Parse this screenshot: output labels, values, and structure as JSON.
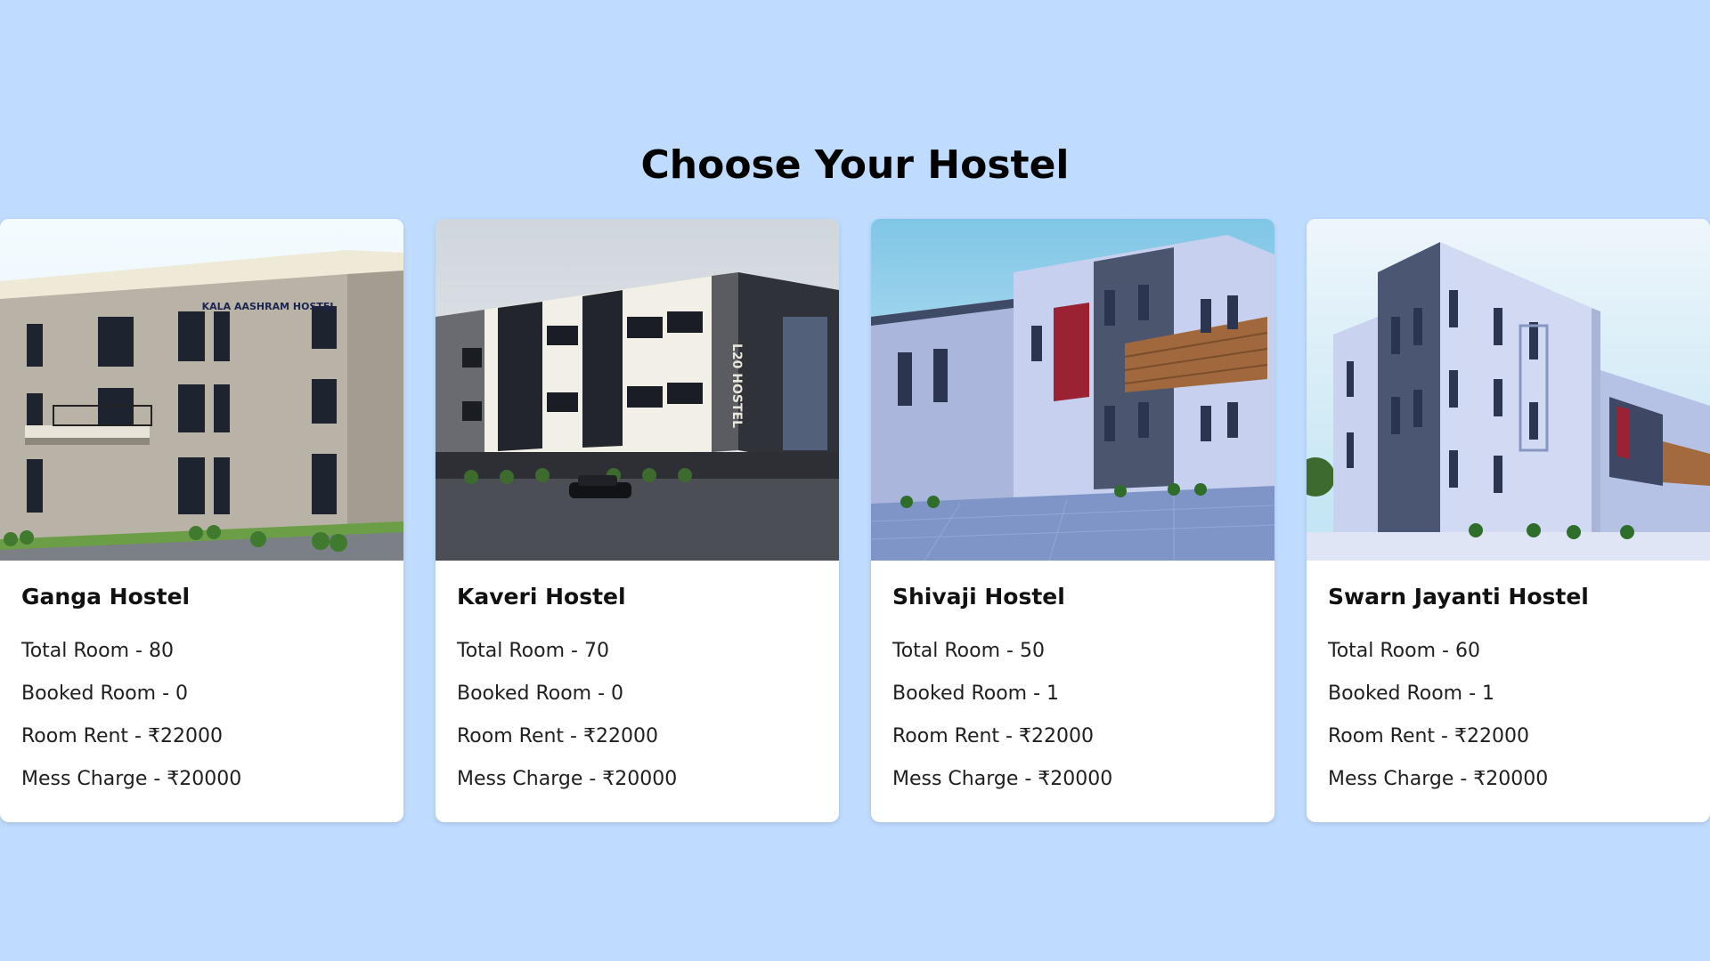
{
  "page": {
    "heading": "Choose Your Hostel",
    "background_color": "#bfdbfe"
  },
  "hostels": [
    {
      "name": "Ganga Hostel",
      "image": "hostel-building-photo",
      "sign_text": "KALA AASHRAM HOSTEL",
      "total_room": "Total Room - 80",
      "booked_room": "Booked Room - 0",
      "room_rent": "Room Rent - ₹22000",
      "mess_charge": "Mess Charge - ₹20000"
    },
    {
      "name": "Kaveri Hostel",
      "image": "hostel-building-photo",
      "sign_text": "L20 HOSTEL",
      "total_room": "Total Room - 70",
      "booked_room": "Booked Room - 0",
      "room_rent": "Room Rent - ₹22000",
      "mess_charge": "Mess Charge - ₹20000"
    },
    {
      "name": "Shivaji Hostel",
      "image": "hostel-building-photo",
      "total_room": "Total Room - 50",
      "booked_room": "Booked Room - 1",
      "room_rent": "Room Rent - ₹22000",
      "mess_charge": "Mess Charge - ₹20000"
    },
    {
      "name": "Swarn Jayanti Hostel",
      "image": "hostel-building-photo",
      "total_room": "Total Room - 60",
      "booked_room": "Booked Room - 1",
      "room_rent": "Room Rent - ₹22000",
      "mess_charge": "Mess Charge - ₹20000"
    }
  ]
}
